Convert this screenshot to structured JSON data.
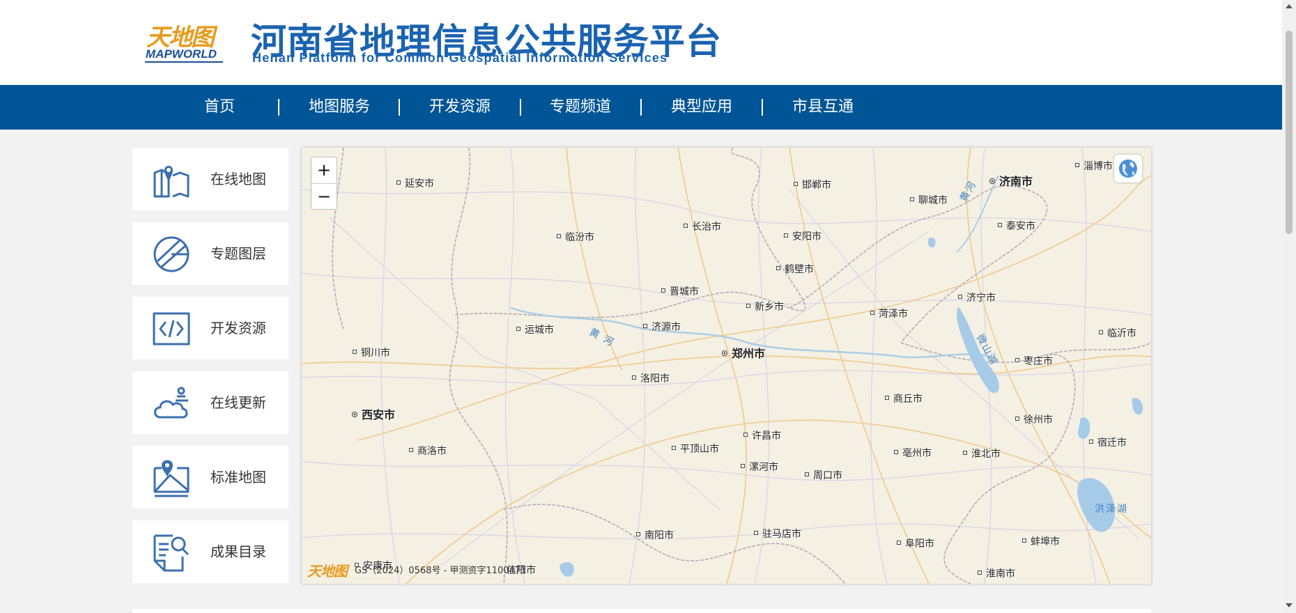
{
  "header": {
    "logo_cn": "天地图",
    "logo_en": "MAPWORLD",
    "title": "河南省地理信息公共服务平台",
    "subtitle": "Henan Platform for Common Geospatial Information Services"
  },
  "nav": {
    "items": [
      "首页",
      "地图服务",
      "开发资源",
      "专题频道",
      "典型应用",
      "市县互通"
    ]
  },
  "sidebar": {
    "items": [
      {
        "label": "在线地图",
        "icon": "map-pin-icon"
      },
      {
        "label": "专题图层",
        "icon": "layers-icon"
      },
      {
        "label": "开发资源",
        "icon": "code-icon"
      },
      {
        "label": "在线更新",
        "icon": "cloud-update-icon"
      },
      {
        "label": "标准地图",
        "icon": "standard-map-icon"
      },
      {
        "label": "成果目录",
        "icon": "catalog-search-icon"
      }
    ]
  },
  "map": {
    "zoom_in": "+",
    "zoom_out": "−",
    "footer_logo": "天地图",
    "footer_text": "GS（2024）0568号 - 甲测资字1100471",
    "cities": [
      "延安市",
      "邯郸市",
      "济南市",
      "淄博市",
      "聊城市",
      "长治市",
      "临汾市",
      "安阳市",
      "泰安市",
      "鹤壁市",
      "晋城市",
      "济宁市",
      "新乡市",
      "菏泽市",
      "运城市",
      "济源市",
      "临沂市",
      "铜川市",
      "郑州市",
      "枣庄市",
      "洛阳市",
      "西安市",
      "商丘市",
      "徐州市",
      "许昌市",
      "商洛市",
      "平顶山市",
      "亳州市",
      "淮北市",
      "宿迁市",
      "漯河市",
      "周口市",
      "南阳市",
      "驻马店市",
      "阜阳市",
      "蚌埠市",
      "安康市",
      "淮南市",
      "信阳市"
    ],
    "water_labels": [
      "黄 河",
      "黄河",
      "微山湖",
      "洪泽湖"
    ]
  },
  "colors": {
    "nav_bg": "#005596",
    "title_blue": "#1a63b0",
    "icon_blue": "#3b6fae",
    "logo_orange": "#e89a1c"
  }
}
